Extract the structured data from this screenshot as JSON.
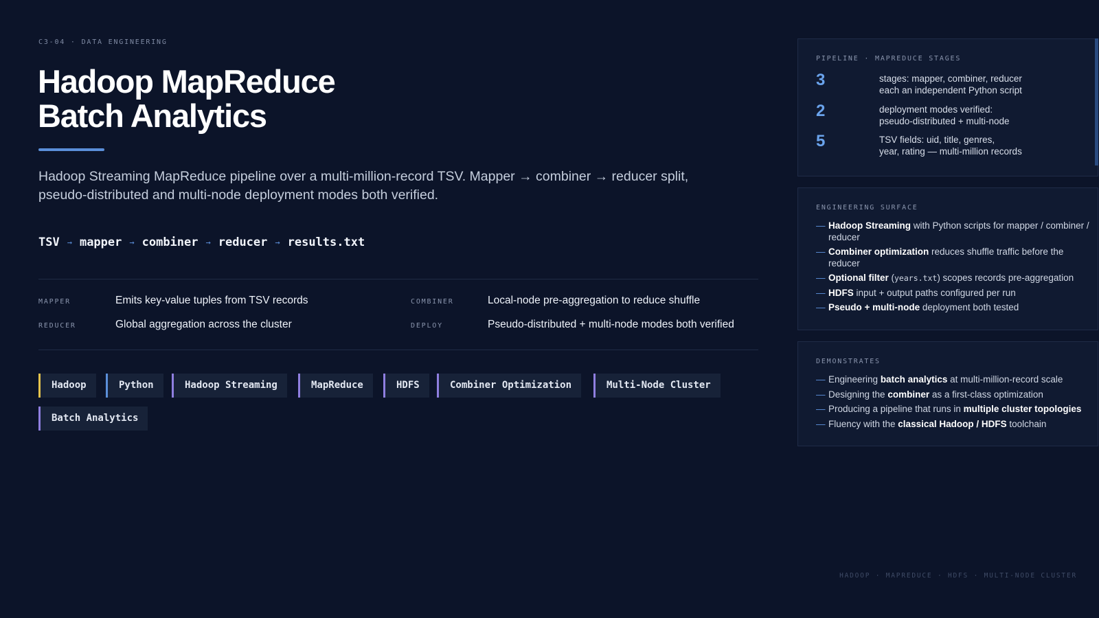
{
  "eyebrow": "C3-04 · DATA ENGINEERING",
  "title": {
    "line1": "Hadoop MapReduce",
    "line2": "Batch Analytics"
  },
  "lede": "Hadoop Streaming MapReduce pipeline over a multi-million-record TSV. Mapper → combiner → reducer split, pseudo-distributed and multi-node deployment modes both verified.",
  "flow": {
    "steps": [
      "TSV",
      "mapper",
      "combiner",
      "reducer",
      "results.txt"
    ],
    "arrow": "→"
  },
  "spec": [
    {
      "key": "MAPPER",
      "value": "Emits key-value tuples from TSV records"
    },
    {
      "key": "COMBINER",
      "value": "Local-node pre-aggregation to reduce shuffle"
    },
    {
      "key": "REDUCER",
      "value": "Global aggregation across the cluster"
    },
    {
      "key": "DEPLOY",
      "value": "Pseudo-distributed + multi-node modes both verified"
    }
  ],
  "tags": [
    {
      "label": "Hadoop",
      "color": "#e6c44c"
    },
    {
      "label": "Python",
      "color": "#5b8fd9"
    },
    {
      "label": "Hadoop Streaming",
      "color": "#8f7fe0"
    },
    {
      "label": "MapReduce",
      "color": "#8f7fe0"
    },
    {
      "label": "HDFS",
      "color": "#8f7fe0"
    },
    {
      "label": "Combiner Optimization",
      "color": "#8f7fe0"
    },
    {
      "label": "Multi-Node Cluster",
      "color": "#8f7fe0"
    },
    {
      "label": "Batch Analytics",
      "color": "#8f7fe0"
    }
  ],
  "pipeline": {
    "title": "PIPELINE · MAPREDUCE STAGES",
    "stats": [
      {
        "num": "3",
        "line1": "stages: mapper, combiner, reducer",
        "line2": "each an independent Python script"
      },
      {
        "num": "2",
        "line1": "deployment modes verified:",
        "line2": "pseudo-distributed + multi-node"
      },
      {
        "num": "5",
        "line1": "TSV fields: uid, title, genres,",
        "line2": "year, rating — multi-million records"
      }
    ]
  },
  "engineering": {
    "title": "ENGINEERING SURFACE",
    "items": [
      {
        "bold": "Hadoop Streaming",
        "rest": " with Python scripts for mapper / combiner / reducer"
      },
      {
        "bold": "Combiner optimization",
        "rest": " reduces shuffle traffic before the reducer"
      },
      {
        "bold": "Optional filter",
        "pre_code": " (",
        "code": "years.txt",
        "rest": ") scopes records pre-aggregation"
      },
      {
        "bold": "HDFS",
        "rest": " input + output paths configured per run"
      },
      {
        "bold": "Pseudo + multi-node",
        "rest": " deployment both tested"
      }
    ]
  },
  "demonstrates": {
    "title": "DEMONSTRATES",
    "items": [
      {
        "pre": "Engineering ",
        "bold": "batch analytics",
        "post": " at multi-million-record scale"
      },
      {
        "pre": "Designing the ",
        "bold": "combiner",
        "post": " as a first-class optimization"
      },
      {
        "pre": "Producing a pipeline that runs in ",
        "bold": "multiple cluster topologies",
        "post": ""
      },
      {
        "pre": "Fluency with the ",
        "bold": "classical Hadoop / HDFS",
        "post": " toolchain"
      }
    ]
  },
  "footer": "HADOOP · MAPREDUCE · HDFS · MULTI-NODE CLUSTER"
}
